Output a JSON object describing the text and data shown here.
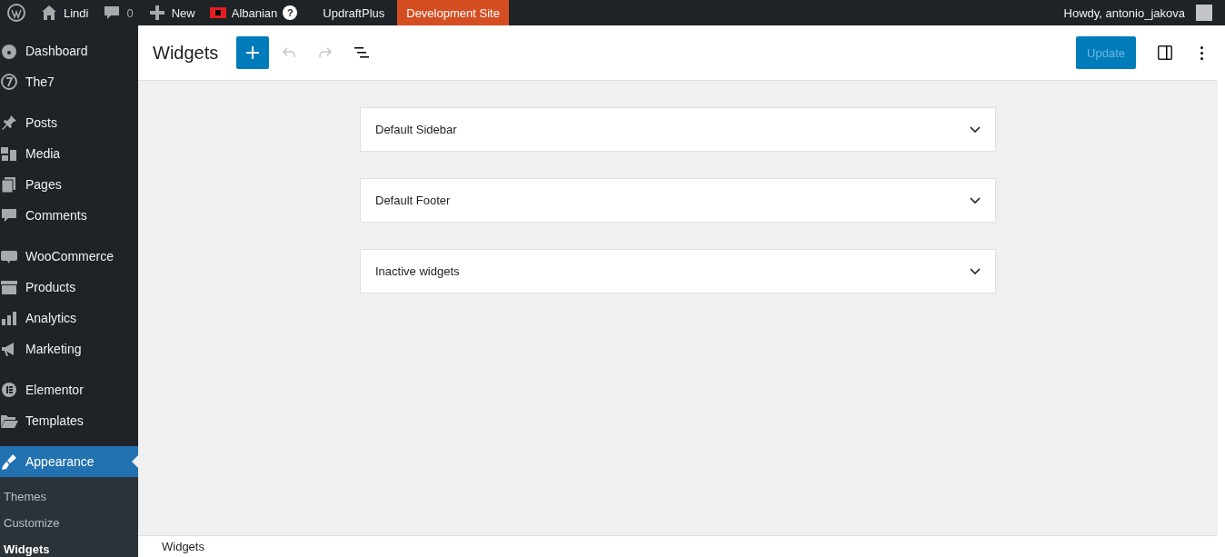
{
  "admin_bar": {
    "site_name": "Lindi",
    "comments_count": "0",
    "new_label": "New",
    "language": "Albanian",
    "help_glyph": "?",
    "updraft": "UpdraftPlus",
    "environment": "Development Site",
    "greeting": "Howdy, antonio_jakova"
  },
  "sidebar": {
    "groups": [
      [
        {
          "label": "Dashboard",
          "selected": false
        },
        {
          "label": "The7",
          "selected": false
        }
      ],
      [
        {
          "label": "Posts",
          "selected": false
        },
        {
          "label": "Media",
          "selected": false
        },
        {
          "label": "Pages",
          "selected": false
        },
        {
          "label": "Comments",
          "selected": false
        }
      ],
      [
        {
          "label": "WooCommerce",
          "selected": false
        },
        {
          "label": "Products",
          "selected": false
        },
        {
          "label": "Analytics",
          "selected": false
        },
        {
          "label": "Marketing",
          "selected": false
        }
      ],
      [
        {
          "label": "Elementor",
          "selected": false
        },
        {
          "label": "Templates",
          "selected": false
        }
      ],
      [
        {
          "label": "Appearance",
          "selected": true,
          "children": [
            {
              "label": "Themes",
              "selected": false
            },
            {
              "label": "Customize",
              "selected": false
            },
            {
              "label": "Widgets",
              "selected": true
            }
          ]
        }
      ]
    ]
  },
  "header": {
    "title": "Widgets",
    "undo": {
      "disabled": true
    },
    "redo": {
      "disabled": true
    },
    "update": {
      "label": "Update",
      "disabled": true
    }
  },
  "areas": [
    {
      "title": "Default Sidebar",
      "expanded": false
    },
    {
      "title": "Default Footer",
      "expanded": false
    },
    {
      "title": "Inactive widgets",
      "expanded": false
    }
  ],
  "footer": {
    "breadcrumb": "Widgets"
  }
}
